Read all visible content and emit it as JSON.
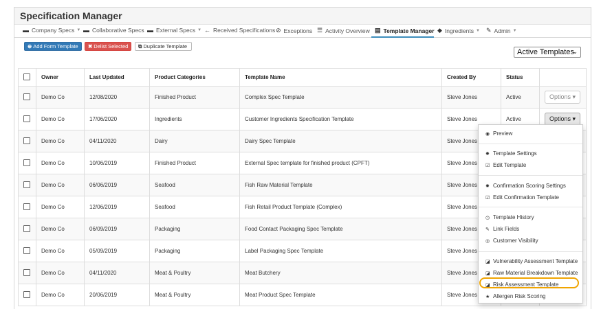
{
  "app": {
    "title": "Specification Manager"
  },
  "nav": [
    {
      "label": "Company Specs",
      "icon": "briefcase-icon",
      "glyph": "▬",
      "caret": true
    },
    {
      "label": "Collaborative Specs",
      "icon": "briefcase-icon",
      "glyph": "▬",
      "caret": false
    },
    {
      "label": "External Specs",
      "icon": "briefcase-icon",
      "glyph": "▬",
      "caret": true
    },
    {
      "label": "Received Specifications",
      "icon": "arrow-left-icon",
      "glyph": "←",
      "caret": false
    },
    {
      "label": "Exceptions",
      "icon": "check-circle-icon",
      "glyph": "⊘",
      "caret": false
    },
    {
      "label": "Activity Overview",
      "icon": "list-icon",
      "glyph": "☰",
      "caret": false
    },
    {
      "label": "Template Manager",
      "icon": "template-icon",
      "glyph": "▤",
      "caret": false,
      "active": true
    },
    {
      "label": "Ingredients",
      "icon": "leaf-icon",
      "glyph": "◆",
      "caret": true
    },
    {
      "label": "Admin",
      "icon": "wrench-icon",
      "glyph": "✎",
      "caret": true
    }
  ],
  "toolbar": {
    "add_label": "Add Form Template",
    "delist_label": "Delist Selected",
    "duplicate_label": "Duplicate Template",
    "filter_value": "Active Templates"
  },
  "table": {
    "headers": [
      "Owner",
      "Last Updated",
      "Product Categories",
      "Template Name",
      "Created By",
      "Status"
    ],
    "rows": [
      {
        "owner": "Demo Co",
        "updated": "12/08/2020",
        "category": "Finished Product",
        "name": "Complex Spec Template",
        "created_by": "Steve Jones",
        "status": "Active"
      },
      {
        "owner": "Demo Co",
        "updated": "17/06/2020",
        "category": "Ingredients",
        "name": "Customer Ingredients Specification Template",
        "created_by": "Steve Jones",
        "status": "Active"
      },
      {
        "owner": "Demo Co",
        "updated": "04/11/2020",
        "category": "Dairy",
        "name": "Dairy Spec Template",
        "created_by": "Steve Jones",
        "status": ""
      },
      {
        "owner": "Demo Co",
        "updated": "10/06/2019",
        "category": "Finished Product",
        "name": "External Spec template for finished product (CPFT)",
        "created_by": "Steve Jones",
        "status": ""
      },
      {
        "owner": "Demo Co",
        "updated": "06/06/2019",
        "category": "Seafood",
        "name": "Fish Raw Material Template",
        "created_by": "Steve Jones",
        "status": ""
      },
      {
        "owner": "Demo Co",
        "updated": "12/06/2019",
        "category": "Seafood",
        "name": "Fish Retail Product Template (Complex)",
        "created_by": "Steve Jones",
        "status": ""
      },
      {
        "owner": "Demo Co",
        "updated": "06/09/2019",
        "category": "Packaging",
        "name": "Food Contact Packaging Spec Template",
        "created_by": "Steve Jones",
        "status": ""
      },
      {
        "owner": "Demo Co",
        "updated": "05/09/2019",
        "category": "Packaging",
        "name": "Label Packaging Spec Template",
        "created_by": "Steve Jones",
        "status": ""
      },
      {
        "owner": "Demo Co",
        "updated": "04/11/2020",
        "category": "Meat & Poultry",
        "name": "Meat Butchery",
        "created_by": "Steve Jones",
        "status": ""
      },
      {
        "owner": "Demo Co",
        "updated": "20/06/2019",
        "category": "Meat & Poultry",
        "name": "Meat Product Spec Template",
        "created_by": "Steve Jones",
        "status": ""
      }
    ],
    "options_label": "Options"
  },
  "dropdown": {
    "groups": [
      [
        {
          "label": "Preview",
          "icon": "eye-icon",
          "glyph": "◉"
        }
      ],
      [
        {
          "label": "Template Settings",
          "icon": "gear-icon",
          "glyph": "✹"
        },
        {
          "label": "Edit Template",
          "icon": "edit-icon",
          "glyph": "☑"
        }
      ],
      [
        {
          "label": "Confirmation Scoring Settings",
          "icon": "gear-icon",
          "glyph": "✹"
        },
        {
          "label": "Edit Confirmation Template",
          "icon": "edit-icon",
          "glyph": "☑"
        }
      ],
      [
        {
          "label": "Template History",
          "icon": "history-icon",
          "glyph": "◷"
        },
        {
          "label": "Link Fields",
          "icon": "link-icon",
          "glyph": "✎"
        },
        {
          "label": "Customer Visibility",
          "icon": "eye-slash-icon",
          "glyph": "◎"
        }
      ],
      [
        {
          "label": "Vulnerability Assessment Template",
          "icon": "template-icon",
          "glyph": "◪"
        },
        {
          "label": "Raw Material Breakdown Template",
          "icon": "template-icon",
          "glyph": "◪"
        },
        {
          "label": "Risk Assessment Template",
          "icon": "template-icon",
          "glyph": "◪",
          "highlighted": true
        },
        {
          "label": "Allergen Risk Scoring",
          "icon": "star-icon",
          "glyph": "★"
        }
      ]
    ]
  },
  "colors": {
    "primary": "#337ab7",
    "danger": "#d9534f",
    "highlight": "#f0a400",
    "active_tab": "#3c8dbc"
  }
}
